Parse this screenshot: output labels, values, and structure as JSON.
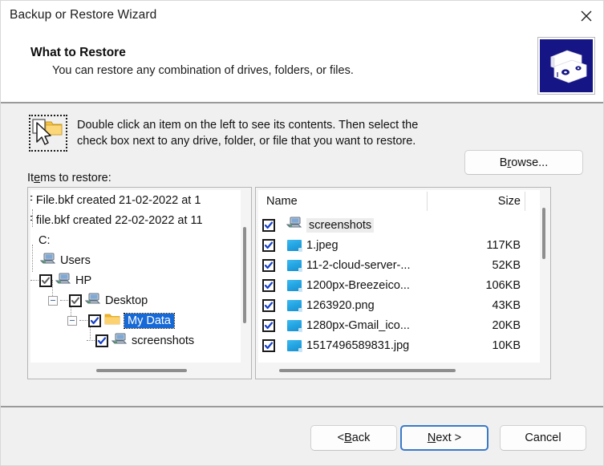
{
  "window": {
    "title": "Backup or Restore Wizard",
    "close_icon": "close-icon"
  },
  "header": {
    "title": "What to Restore",
    "subtitle": "You can restore any combination of drives, folders, or files.",
    "icon": "tape-backup-icon"
  },
  "instructions": {
    "icon": "cursor-folder-icon",
    "line1": "Double click an item on the left to see its contents. Then select the",
    "line2": "check box next to any drive, folder, or file that you want to restore."
  },
  "browse_button": {
    "label_before": "B",
    "label_accel": "r",
    "label_after": "owse..."
  },
  "items_label": {
    "before": "It",
    "accel": "e",
    "after": "ms to restore:"
  },
  "tree": {
    "rows": [
      {
        "label": "F File.bkf created 21-02-2022 at 1",
        "icon": "none",
        "check": "none",
        "indent": 0
      },
      {
        "label": "F file.bkf created 22-02-2022 at 11",
        "icon": "none",
        "check": "none",
        "indent": 0
      },
      {
        "label": "C:",
        "icon": "none",
        "check": "none",
        "indent": 0
      },
      {
        "label": "Users",
        "icon": "computer-icon",
        "check": "none",
        "indent": 1
      },
      {
        "label": "HP",
        "icon": "computer-icon",
        "check": "gray",
        "indent": 2
      },
      {
        "label": "Desktop",
        "icon": "computer-icon",
        "check": "gray",
        "indent": 3,
        "expander": "minus"
      },
      {
        "label": "My Data",
        "icon": "folder-icon",
        "check": "blue",
        "indent": 4,
        "expander": "minus",
        "selected": true
      },
      {
        "label": "screenshots",
        "icon": "computer-icon",
        "check": "blue",
        "indent": 5
      }
    ]
  },
  "file_list": {
    "columns": {
      "name": "Name",
      "size": "Size"
    },
    "rows": [
      {
        "name": "screenshots",
        "size": "",
        "icon": "computer-icon",
        "checked": true,
        "shaded": true
      },
      {
        "name": "1.jpeg",
        "size": "117KB",
        "icon": "image-icon",
        "checked": true
      },
      {
        "name": "11-2-cloud-server-...",
        "size": "52KB",
        "icon": "image-icon",
        "checked": true
      },
      {
        "name": "1200px-Breezeico...",
        "size": "106KB",
        "icon": "image-icon",
        "checked": true
      },
      {
        "name": "1263920.png",
        "size": "43KB",
        "icon": "image-icon",
        "checked": true
      },
      {
        "name": "1280px-Gmail_ico...",
        "size": "20KB",
        "icon": "image-icon",
        "checked": true
      },
      {
        "name": "1517496589831.jpg",
        "size": "10KB",
        "icon": "image-icon",
        "checked": true
      }
    ]
  },
  "footer": {
    "back": {
      "before": "< ",
      "accel": "B",
      "after": "ack"
    },
    "next": {
      "before": "",
      "accel": "N",
      "after": "ext >"
    },
    "cancel": {
      "label": "Cancel"
    }
  },
  "colors": {
    "accent_blue": "#1669d6",
    "focus_blue": "#3a79c8",
    "icon_navy": "#151585",
    "folder_yellow": "#f6c244",
    "body_gray": "#f0f0f0"
  }
}
